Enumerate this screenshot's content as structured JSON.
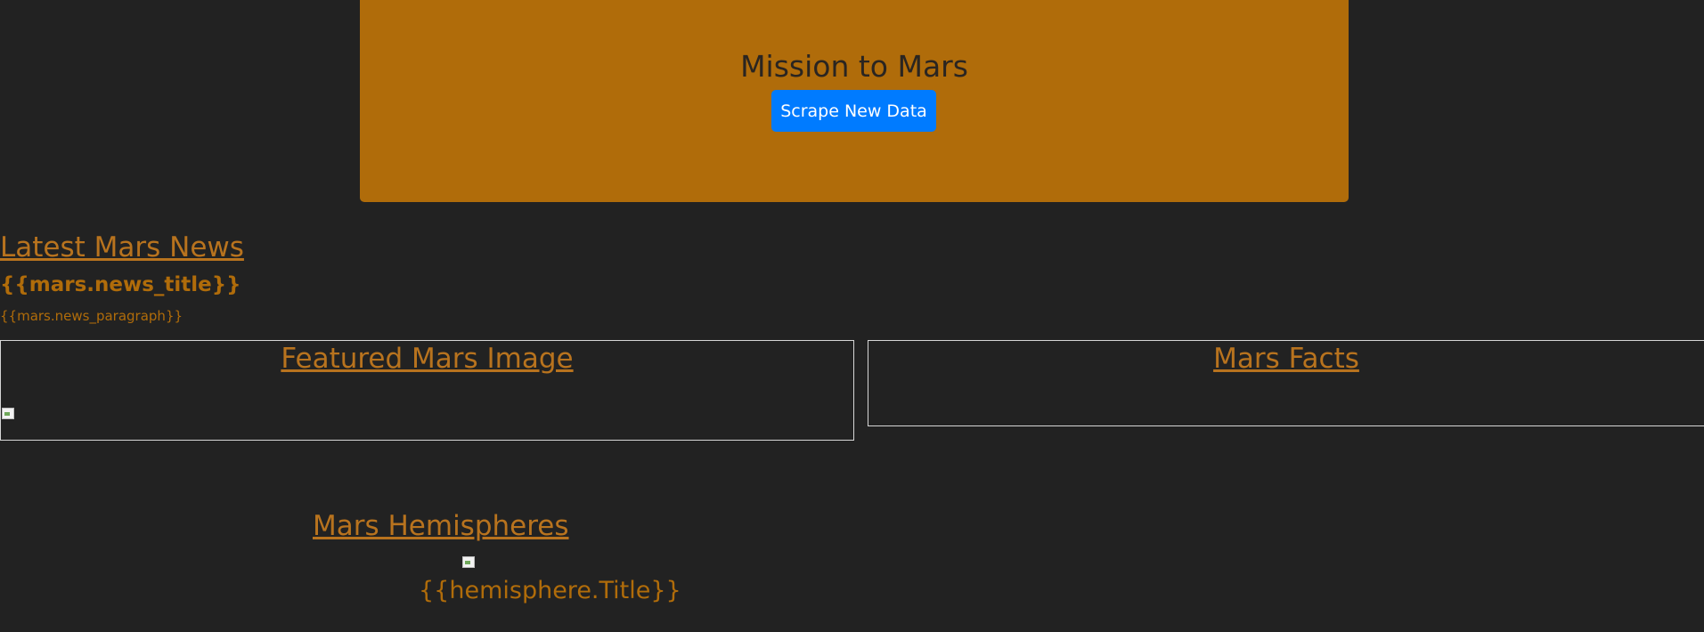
{
  "header": {
    "title": "Mission to Mars",
    "scrape_button_label": "Scrape New Data",
    "accent_color": "#b06c0a",
    "button_color": "#007bff"
  },
  "news": {
    "section_title": "Latest Mars News",
    "headline": "{{mars.news_title}}",
    "paragraph": "{{mars.news_paragraph}}"
  },
  "featured_image": {
    "section_title": "Featured Mars Image"
  },
  "facts": {
    "section_title": "Mars Facts"
  },
  "hemispheres": {
    "section_title": "Mars Hemispheres",
    "item_title": "{{hemisphere.Title}}"
  }
}
